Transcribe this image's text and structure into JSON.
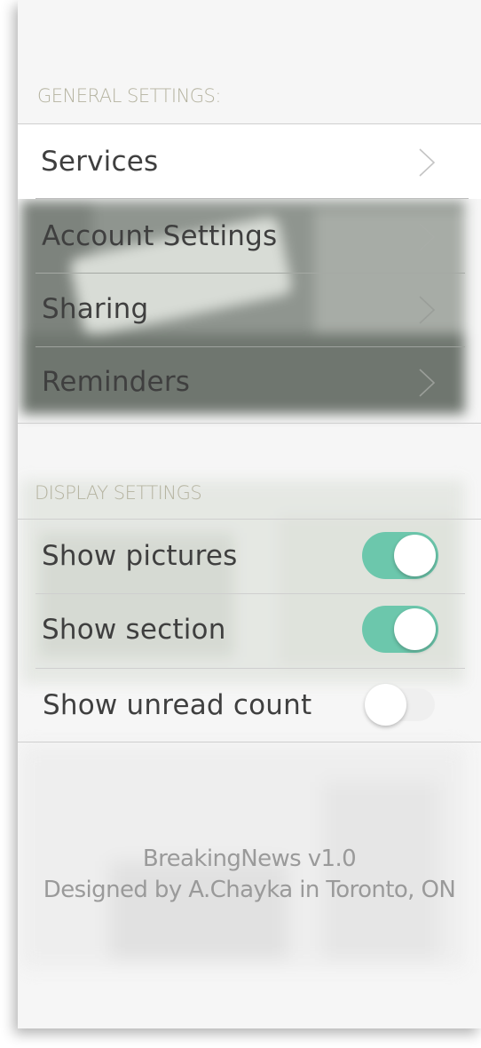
{
  "general_settings": {
    "title": "GENERAL SETTINGS:",
    "items": [
      {
        "label": "Services"
      },
      {
        "label": "Account Settings"
      },
      {
        "label": "Sharing"
      },
      {
        "label": "Reminders"
      }
    ]
  },
  "display_settings": {
    "title": "DISPLAY SETTINGS",
    "items": [
      {
        "label": "Show pictures",
        "enabled": true
      },
      {
        "label": "Show section",
        "enabled": true
      },
      {
        "label": "Show unread count",
        "enabled": false
      }
    ]
  },
  "footer": {
    "app_version": "BreakingNews v1.0",
    "credit": "Designed by A.Chayka in Toronto, ON"
  },
  "colors": {
    "toggle_on": "#6cc7ac",
    "section_title": "#b5b3a0",
    "label_text": "#3f3f3f"
  }
}
